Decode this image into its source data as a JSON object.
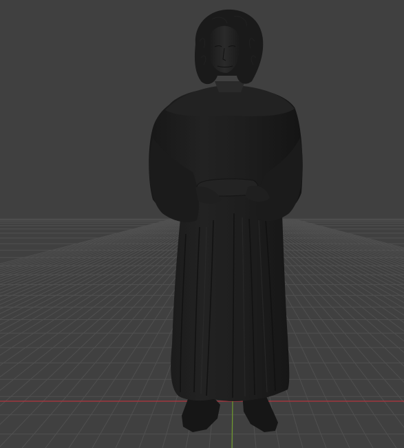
{
  "viewport": {
    "background_color": "#404040",
    "grid_color": "#505050",
    "x_axis_color": "#b3343d",
    "y_axis_color": "#6e9a2c",
    "model_color": "#1d1d1d",
    "model_shadow_color": "#121212",
    "model_highlight_color": "#2b2b2b",
    "shading_mode": "solid"
  },
  "model": {
    "subject": "standing-robed-figure"
  },
  "icons": {
    "axis_x": "x-axis-line",
    "axis_y": "y-axis-line",
    "grid": "floor-grid"
  }
}
